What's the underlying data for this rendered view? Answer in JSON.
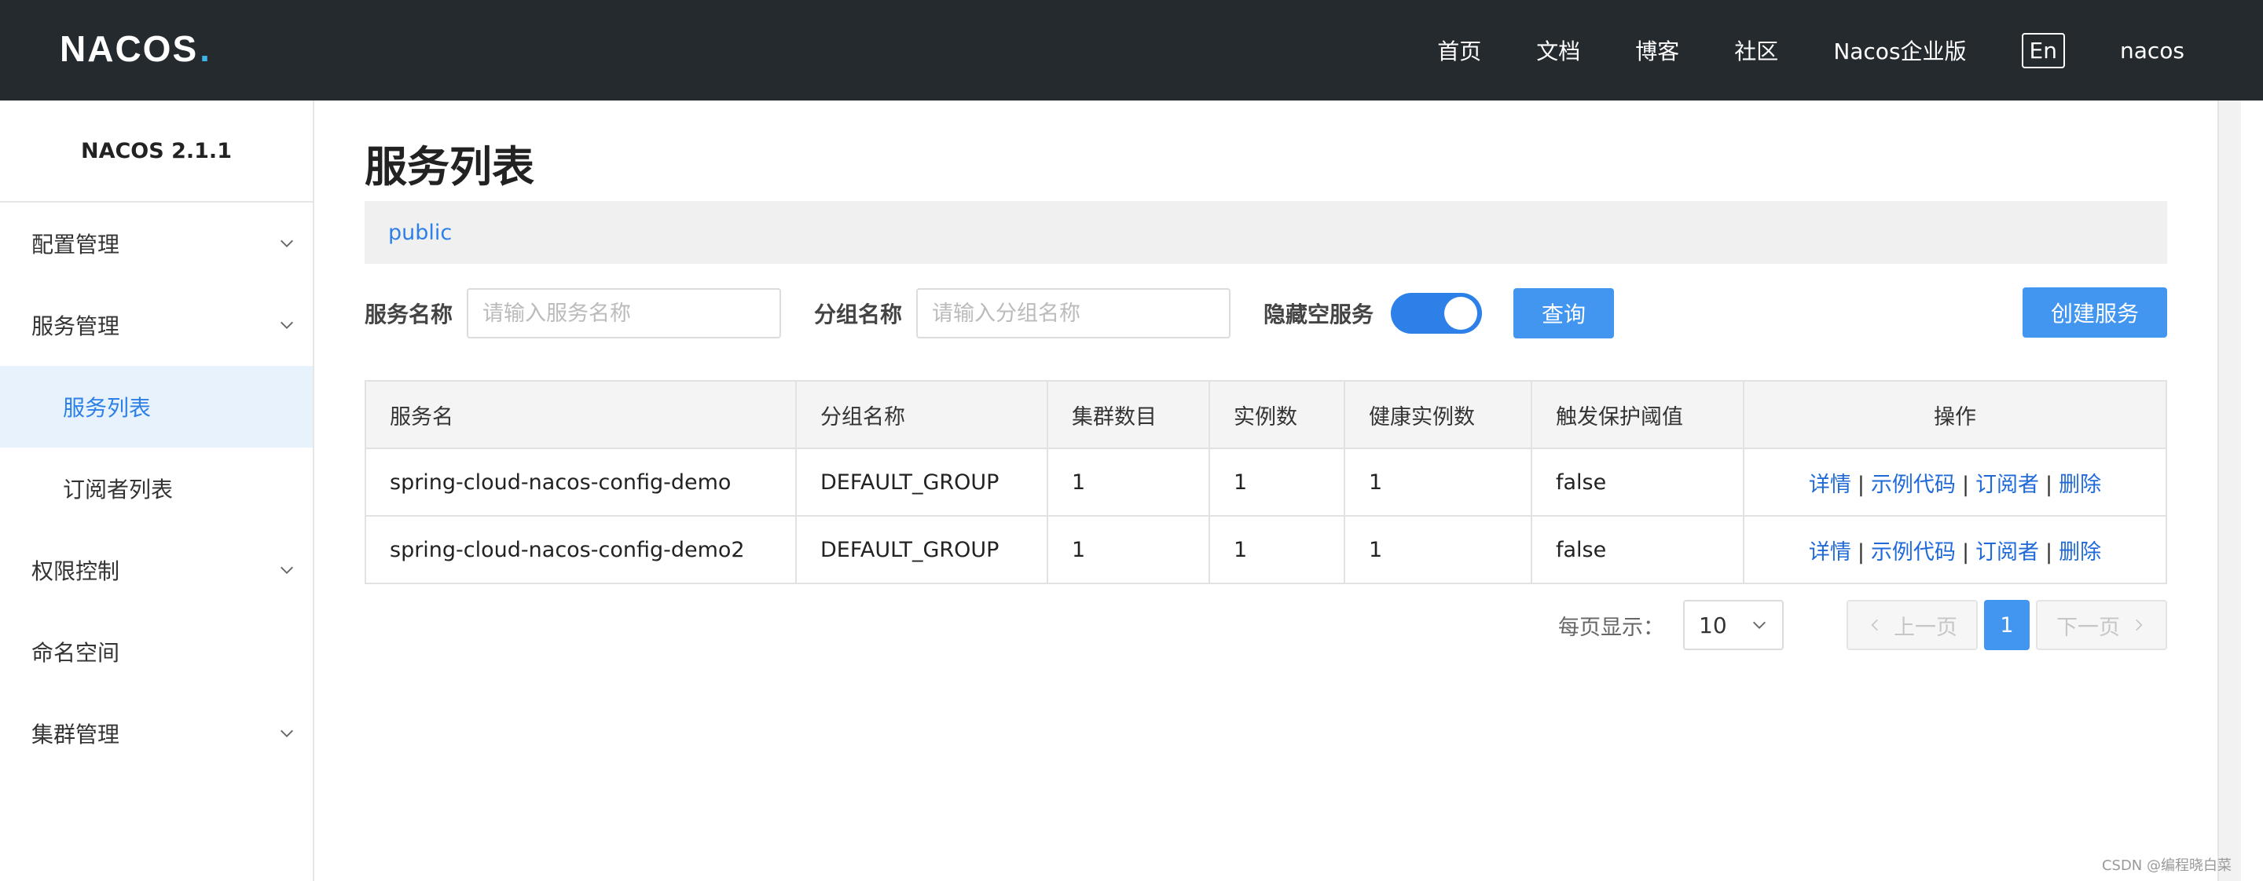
{
  "header": {
    "logo_text": "NACOS",
    "logo_dot": ".",
    "nav": [
      "首页",
      "文档",
      "博客",
      "社区",
      "Nacos企业版"
    ],
    "lang": "En",
    "user": "nacos",
    "accent_color": "#3eb5e8"
  },
  "sidebar": {
    "version": "NACOS 2.1.1",
    "items": [
      {
        "label": "配置管理",
        "expandable": true
      },
      {
        "label": "服务管理",
        "expandable": true
      },
      {
        "label": "服务列表",
        "sub": true,
        "active": true
      },
      {
        "label": "订阅者列表",
        "sub": true
      },
      {
        "label": "权限控制",
        "expandable": true
      },
      {
        "label": "命名空间",
        "expandable": false
      },
      {
        "label": "集群管理",
        "expandable": true
      }
    ]
  },
  "main": {
    "title": "服务列表",
    "namespace": "public",
    "filters": {
      "service_label": "服务名称",
      "service_placeholder": "请输入服务名称",
      "group_label": "分组名称",
      "group_placeholder": "请输入分组名称",
      "hide_empty_label": "隐藏空服务",
      "hide_empty_on": true,
      "query_button": "查询",
      "create_button": "创建服务"
    },
    "table": {
      "headers": [
        "服务名",
        "分组名称",
        "集群数目",
        "实例数",
        "健康实例数",
        "触发保护阈值",
        "操作"
      ],
      "rows": [
        [
          "spring-cloud-nacos-config-demo",
          "DEFAULT_GROUP",
          "1",
          "1",
          "1",
          "false"
        ],
        [
          "spring-cloud-nacos-config-demo2",
          "DEFAULT_GROUP",
          "1",
          "1",
          "1",
          "false"
        ]
      ],
      "actions": [
        "详情",
        "示例代码",
        "订阅者",
        "删除"
      ],
      "action_sep": "|"
    },
    "pagination": {
      "page_size_label": "每页显示：",
      "page_size": "10",
      "prev": "上一页",
      "next": "下一页",
      "current_page": "1"
    }
  },
  "watermark": "CSDN @编程晓白菜",
  "colors": {
    "topbar": "#252a2f",
    "primary": "#4296f0",
    "link": "#1f6ad8",
    "active_bg": "#e8f2fd"
  }
}
